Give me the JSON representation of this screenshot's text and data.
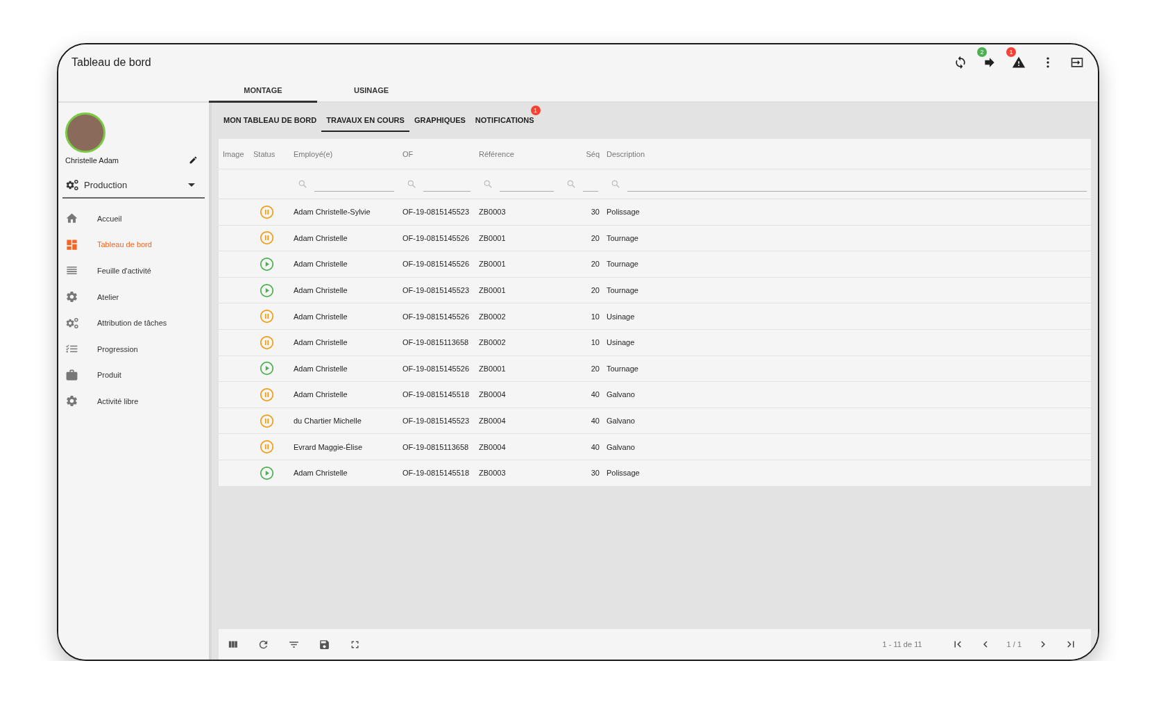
{
  "window": {
    "title": "Tableau de bord"
  },
  "actions": [
    {
      "kind": "sync"
    },
    {
      "kind": "forward",
      "badge": "2",
      "color": "#4caf50"
    },
    {
      "kind": "alert",
      "badge": "1",
      "color": "#f44336"
    },
    {
      "kind": "more"
    },
    {
      "kind": "exit"
    }
  ],
  "tabs": [
    {
      "label": "MONTAGE",
      "selected": true
    },
    {
      "label": "USINAGE",
      "selected": false
    }
  ],
  "user": {
    "name": "Christelle Adam"
  },
  "profile_select": {
    "value": "Production"
  },
  "sidebar": {
    "items": [
      {
        "kind": "home",
        "label": "Accueil",
        "selected": false
      },
      {
        "kind": "dashboard",
        "label": "Tableau de bord",
        "selected": true
      },
      {
        "kind": "lines",
        "label": "Feuille d'activité",
        "selected": false
      },
      {
        "kind": "gear",
        "label": "Atelier",
        "selected": false
      },
      {
        "kind": "gears",
        "label": "Attribution de tâches",
        "selected": false
      },
      {
        "kind": "checklist",
        "label": "Progression",
        "selected": false
      },
      {
        "kind": "briefcase",
        "label": "Produit",
        "selected": false
      },
      {
        "kind": "gear",
        "label": "Activité libre",
        "selected": false
      }
    ]
  },
  "subtabs": [
    {
      "label": "MON TABLEAU DE BORD",
      "selected": false
    },
    {
      "label": "TRAVAUX EN COURS",
      "selected": true
    },
    {
      "label": "GRAPHIQUES",
      "selected": false
    },
    {
      "label": "NOTIFICATIONS",
      "selected": false,
      "badge": "1"
    }
  ],
  "table": {
    "columns": [
      "Image",
      "Status",
      "Employé(e)",
      "OF",
      "Référence",
      "Séq",
      "Description"
    ],
    "rows": [
      {
        "kind": "paused",
        "employee": "Adam Christelle-Sylvie",
        "of": "OF-19-0815145523",
        "reference": "ZB0003",
        "seq": "30",
        "description": "Polissage"
      },
      {
        "kind": "paused",
        "employee": "Adam Christelle",
        "of": "OF-19-0815145526",
        "reference": "ZB0001",
        "seq": "20",
        "description": "Tournage"
      },
      {
        "kind": "running",
        "employee": "Adam Christelle",
        "of": "OF-19-0815145526",
        "reference": "ZB0001",
        "seq": "20",
        "description": "Tournage"
      },
      {
        "kind": "running",
        "employee": "Adam Christelle",
        "of": "OF-19-0815145523",
        "reference": "ZB0001",
        "seq": "20",
        "description": "Tournage"
      },
      {
        "kind": "paused",
        "employee": "Adam Christelle",
        "of": "OF-19-0815145526",
        "reference": "ZB0002",
        "seq": "10",
        "description": "Usinage"
      },
      {
        "kind": "paused",
        "employee": "Adam Christelle",
        "of": "OF-19-0815113658",
        "reference": "ZB0002",
        "seq": "10",
        "description": "Usinage"
      },
      {
        "kind": "running",
        "employee": "Adam Christelle",
        "of": "OF-19-0815145526",
        "reference": "ZB0001",
        "seq": "20",
        "description": "Tournage"
      },
      {
        "kind": "paused",
        "employee": "Adam Christelle",
        "of": "OF-19-0815145518",
        "reference": "ZB0004",
        "seq": "40",
        "description": "Galvano"
      },
      {
        "kind": "paused",
        "employee": "du Chartier Michelle",
        "of": "OF-19-0815145523",
        "reference": "ZB0004",
        "seq": "40",
        "description": "Galvano"
      },
      {
        "kind": "paused",
        "employee": "Evrard Maggie-Élise",
        "of": "OF-19-0815113658",
        "reference": "ZB0004",
        "seq": "40",
        "description": "Galvano"
      },
      {
        "kind": "running",
        "employee": "Adam Christelle",
        "of": "OF-19-0815145518",
        "reference": "ZB0003",
        "seq": "30",
        "description": "Polissage"
      }
    ]
  },
  "pagination": {
    "range": "1 - 11 de 11",
    "page": "1 / 1"
  }
}
